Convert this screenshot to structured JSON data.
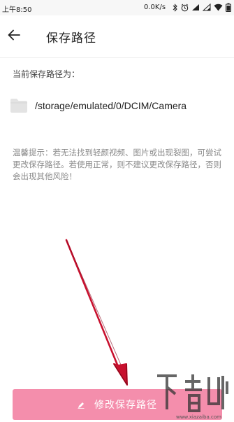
{
  "status_bar": {
    "time": "上午8:50",
    "network_speed": "0.0K/s",
    "icons": [
      "bluetooth-icon",
      "alarm-icon",
      "sim-signal-icon",
      "sim-signal-icon",
      "wifi-icon",
      "battery-icon"
    ]
  },
  "header": {
    "back_icon": "arrow-left-icon",
    "title": "保存路径"
  },
  "content": {
    "path_label": "当前保存路径为：",
    "folder_icon": "folder-icon",
    "path_value": "/storage/emulated/0/DCIM/Camera",
    "tip": "温馨提示：若无法找到轻颜视频、图片或出现裂图，可尝试更改保存路径。若使用正常，则不建议更改保存路径，否则会出现其他风险！"
  },
  "bottom_button": {
    "icon": "pencil-icon",
    "label": "修改保存路径"
  },
  "overlay": {
    "arrow_color": "#c8102e"
  },
  "watermark": {
    "logo_text": "下载吧",
    "url": "www.xiazaiba.com"
  },
  "colors": {
    "button": "#f48eac",
    "tip_text": "#8a8a8a"
  }
}
